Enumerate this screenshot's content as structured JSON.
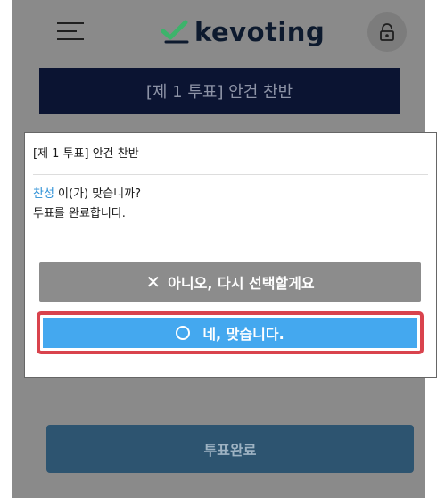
{
  "header": {
    "logo_text": "kevoting"
  },
  "vote_banner": "[제 1 투표] 안건 찬반",
  "modal": {
    "title": "[제 1 투표] 안건 찬반",
    "choice_word": "찬성",
    "question_suffix": " 이(가) 맞습니까?",
    "subtext": "투표를 완료합니다.",
    "no_button_label": "아니오, 다시 선택할게요",
    "yes_button_label": "네, 맞습니다."
  },
  "complete_button_label": "투표완료",
  "colors": {
    "brand_navy": "#0b1432",
    "choice_accent": "#2b8fd6",
    "confirm_blue": "#44a8ef",
    "highlight_red": "#d9434d",
    "cancel_gray": "#8c8c8c",
    "logo_green": "#3db36b"
  },
  "icons": {
    "menu": "hamburger-menu-icon",
    "lock": "lock-icon",
    "no": "x-icon",
    "yes": "circle-icon",
    "logo": "checkmark-logo-icon"
  }
}
